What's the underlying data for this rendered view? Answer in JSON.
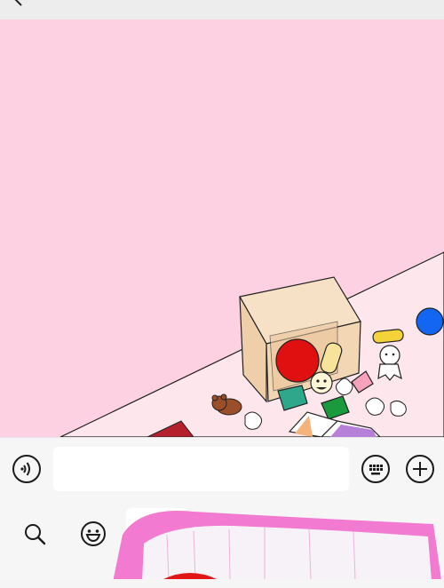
{
  "header": {
    "title": "",
    "back_icon": "chevron-left-icon"
  },
  "stage": {
    "background": "#fdd0e2",
    "floor_color": "#fde6ec",
    "scene": "cardboard-box-spilling-toys"
  },
  "input_bar": {
    "voice_icon": "voice-icon",
    "message_value": "",
    "keyboard_icon": "keyboard-icon",
    "add_icon": "plus-circle-icon"
  },
  "toolbar": {
    "search_icon": "search-icon",
    "emoji_icon": "emoji-icon"
  },
  "colors": {
    "box": "#f3d6b4",
    "ball_red": "#e01010",
    "ball_blue": "#1366f2",
    "panel_pink": "#f27ad0"
  }
}
